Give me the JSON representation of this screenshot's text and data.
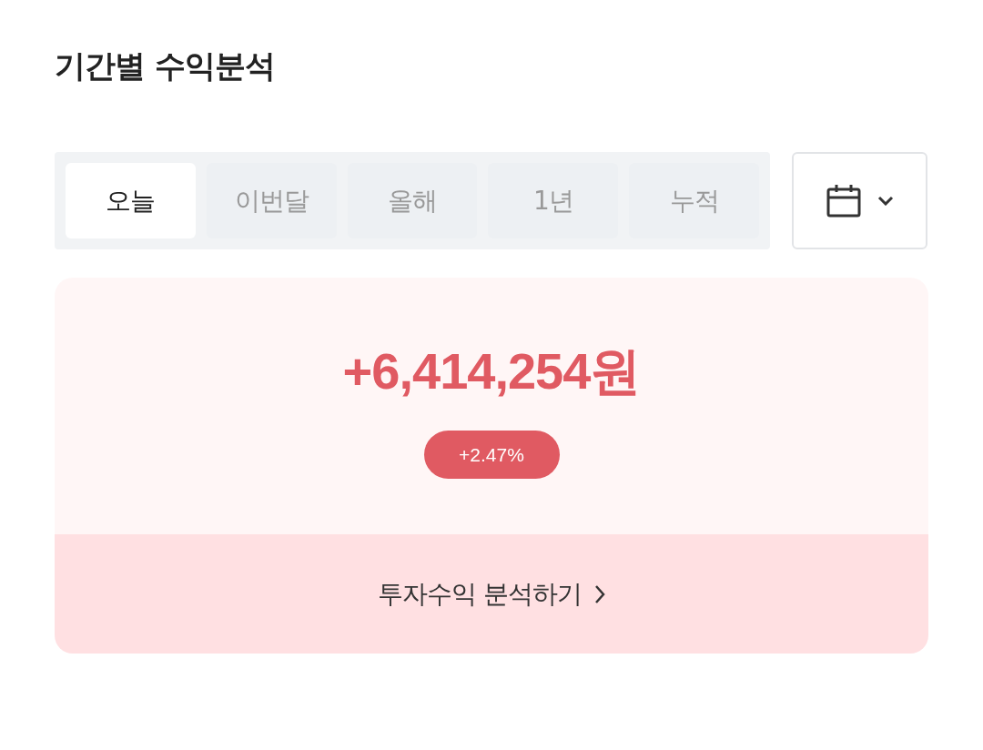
{
  "title": "기간별 수익분석",
  "tabs": [
    {
      "label": "오늘",
      "selected": true
    },
    {
      "label": "이번달",
      "selected": false
    },
    {
      "label": "올해",
      "selected": false
    },
    {
      "label": "1년",
      "selected": false
    },
    {
      "label": "누적",
      "selected": false
    }
  ],
  "summary": {
    "amount": "+6,414,254원",
    "rate": "+2.47%",
    "link": "투자수익 분석하기"
  }
}
